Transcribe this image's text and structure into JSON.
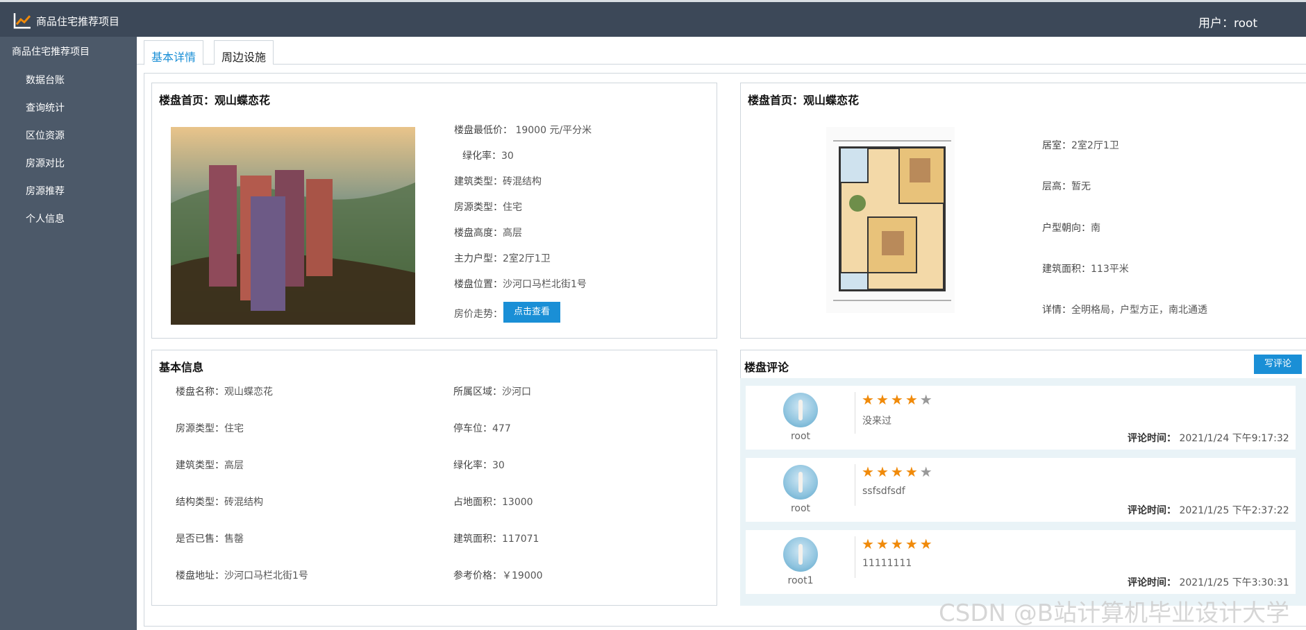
{
  "header": {
    "app_title": "商品住宅推荐项目",
    "user": "用户：root"
  },
  "sidebar": {
    "title": "商品住宅推荐项目",
    "items": [
      {
        "label": "数据台账"
      },
      {
        "label": "查询统计"
      },
      {
        "label": "区位资源"
      },
      {
        "label": "房源对比"
      },
      {
        "label": "房源推荐"
      },
      {
        "label": "个人信息"
      }
    ]
  },
  "tabs": [
    {
      "label": "基本详情",
      "active": true
    },
    {
      "label": "周边设施",
      "active": false
    }
  ],
  "overview": {
    "title": "楼盘首页：观山蝶恋花",
    "fields": [
      {
        "label": "楼盘最低价：",
        "value": "19000 元/平分米"
      },
      {
        "label": "绿化率：",
        "value": "30"
      },
      {
        "label": "建筑类型：",
        "value": "砖混结构"
      },
      {
        "label": "房源类型：",
        "value": "住宅"
      },
      {
        "label": "楼盘高度：",
        "value": "高层"
      },
      {
        "label": "主力户型：",
        "value": "2室2厅1卫"
      },
      {
        "label": "楼盘位置：",
        "value": "沙河口马栏北街1号"
      }
    ],
    "price_trend_label": "房价走势：",
    "view_button": "点击查看"
  },
  "floorplan": {
    "title": "楼盘首页：观山蝶恋花",
    "fields": [
      {
        "label": "居室：",
        "value": "2室2厅1卫"
      },
      {
        "label": "层高：",
        "value": "暂无"
      },
      {
        "label": "户型朝向：",
        "value": "南"
      },
      {
        "label": "建筑面积：",
        "value": "113平米"
      },
      {
        "label": "详情：",
        "value": "全明格局，户型方正，南北通透"
      }
    ]
  },
  "basic_info": {
    "title": "基本信息",
    "left": [
      {
        "label": "楼盘名称：",
        "value": "观山蝶恋花"
      },
      {
        "label": "房源类型：",
        "value": "住宅"
      },
      {
        "label": "建筑类型：",
        "value": "高层"
      },
      {
        "label": "结构类型：",
        "value": "砖混结构"
      },
      {
        "label": "是否已售：",
        "value": "售罄"
      },
      {
        "label": "楼盘地址：",
        "value": "沙河口马栏北街1号"
      }
    ],
    "right": [
      {
        "label": "所属区域：",
        "value": "沙河口"
      },
      {
        "label": "停车位：",
        "value": "477"
      },
      {
        "label": "绿化率：",
        "value": "30"
      },
      {
        "label": "占地面积：",
        "value": "13000"
      },
      {
        "label": "建筑面积：",
        "value": "117071"
      },
      {
        "label": "参考价格：",
        "value": "￥19000"
      }
    ]
  },
  "comments": {
    "title": "楼盘评论",
    "write_button": "写评论",
    "time_label": "评论时间：",
    "items": [
      {
        "user": "root",
        "rating": 4,
        "text": "没来过",
        "time": "2021/1/24 下午9:17:32"
      },
      {
        "user": "root",
        "rating": 4,
        "text": "ssfsdfsdf",
        "time": "2021/1/25 下午2:37:22"
      },
      {
        "user": "root1",
        "rating": 5,
        "text": "11111111",
        "time": "2021/1/25 下午3:30:31"
      }
    ]
  },
  "watermark": "CSDN @B站计算机毕业设计大学"
}
